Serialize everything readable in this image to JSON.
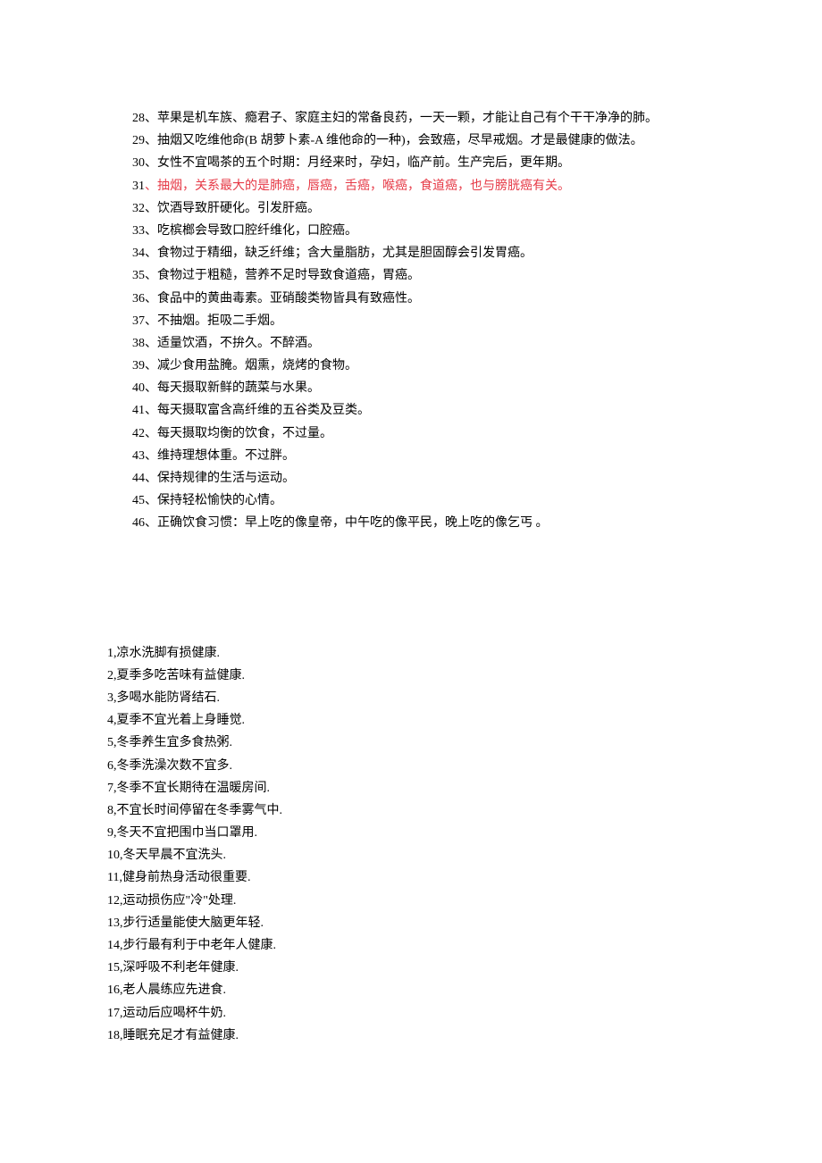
{
  "section1": {
    "items": [
      {
        "num": "28",
        "text": "、苹果是机车族、瘾君子、家庭主妇的常备良药，一天一颗，才能让自己有个干干净净的肺。",
        "indent": true,
        "highlight": false
      },
      {
        "num": "29",
        "text": "、抽烟又吃维他命(B 胡萝卜素-A 维他命的一种)，会致癌，尽早戒烟。才是最健康的做法。",
        "indent": true,
        "highlight": false
      },
      {
        "num": "30",
        "text": "、女性不宜喝茶的五个时期：月经来时，孕妇，临产前。生产完后，更年期。",
        "indent": true,
        "highlight": false
      },
      {
        "num": "31",
        "text": "、抽烟，关系最大的是肺癌，唇癌，舌癌，喉癌，食道癌，也与膀胱癌有关。",
        "indent": true,
        "highlight": true
      },
      {
        "num": "32",
        "text": "、饮酒导致肝硬化。引发肝癌。",
        "indent": true,
        "highlight": false
      },
      {
        "num": "33",
        "text": "、吃槟榔会导致口腔纤维化，口腔癌。",
        "indent": true,
        "highlight": false
      },
      {
        "num": "34",
        "text": "、食物过于精细，缺乏纤维；含大量脂肪，尤其是胆固醇会引发胃癌。",
        "indent": true,
        "highlight": false
      },
      {
        "num": "35",
        "text": "、食物过于粗糙，营养不足时导致食道癌，胃癌。",
        "indent": true,
        "highlight": false
      },
      {
        "num": "36",
        "text": "、食品中的黄曲毒素。亚硝酸类物皆具有致癌性。",
        "indent": true,
        "highlight": false
      },
      {
        "num": "37",
        "text": "、不抽烟。拒吸二手烟。",
        "indent": true,
        "highlight": false
      },
      {
        "num": "38",
        "text": "、适量饮酒，不拚久。不醉酒。",
        "indent": true,
        "highlight": false
      },
      {
        "num": "39",
        "text": "、减少食用盐腌。烟熏，烧烤的食物。",
        "indent": true,
        "highlight": false
      },
      {
        "num": "40",
        "text": "、每天摄取新鲜的蔬菜与水果。",
        "indent": true,
        "highlight": false
      },
      {
        "num": "41",
        "text": "、每天摄取富含高纤维的五谷类及豆类。",
        "indent": true,
        "highlight": false
      },
      {
        "num": "42",
        "text": "、每天摄取均衡的饮食，不过量。",
        "indent": true,
        "highlight": false
      },
      {
        "num": "43",
        "text": "、维持理想体重。不过胖。",
        "indent": true,
        "highlight": false
      },
      {
        "num": "44",
        "text": "、保持规律的生活与运动。",
        "indent": true,
        "highlight": false
      },
      {
        "num": "45",
        "text": "、保持轻松愉快的心情。",
        "indent": true,
        "highlight": false
      },
      {
        "num": "46",
        "text": "、正确饮食习惯：早上吃的像皇帝，中午吃的像平民，晚上吃的像乞丐 。",
        "indent": true,
        "highlight": false
      }
    ]
  },
  "section2": {
    "items": [
      "1,凉水洗脚有损健康.",
      "2,夏季多吃苦味有益健康.",
      "3,多喝水能防肾结石.",
      "4,夏季不宜光着上身睡觉.",
      "5,冬季养生宜多食热粥.",
      "6,冬季洗澡次数不宜多.",
      "7,冬季不宜长期待在温暖房间.",
      "8,不宜长时间停留在冬季雾气中.",
      "9,冬天不宜把围巾当口罩用.",
      "10,冬天早晨不宜洗头.",
      "11,健身前热身活动很重要.",
      "12,运动损伤应\"冷\"处理.",
      "13,步行适量能使大脑更年轻.",
      "14,步行最有利于中老年人健康.",
      "15,深呼吸不利老年健康.",
      "16,老人晨练应先进食.",
      "17,运动后应喝杯牛奶.",
      "18,睡眠充足才有益健康."
    ]
  }
}
